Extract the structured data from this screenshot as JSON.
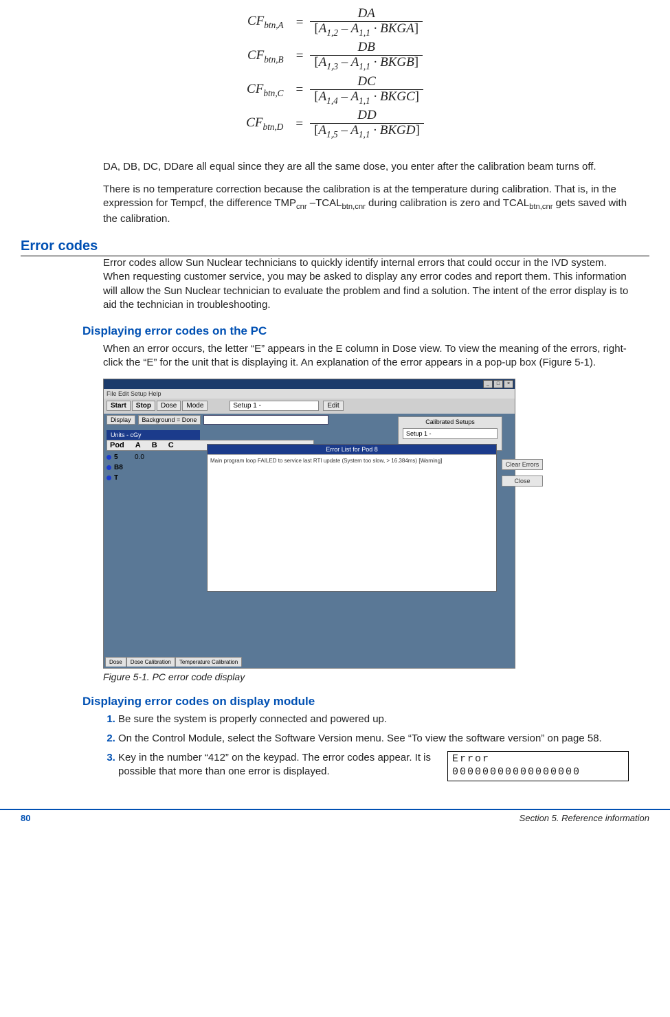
{
  "equations": [
    {
      "lhs_base": "CF",
      "lhs_sub": "btn,A",
      "num": "DA",
      "den_a2": "1,2",
      "den_a1": "1,1",
      "den_bk": "BKGA"
    },
    {
      "lhs_base": "CF",
      "lhs_sub": "btn,B",
      "num": "DB",
      "den_a2": "1,3",
      "den_a1": "1,1",
      "den_bk": "BKGB"
    },
    {
      "lhs_base": "CF",
      "lhs_sub": "btn,C",
      "num": "DC",
      "den_a2": "1,4",
      "den_a1": "1,1",
      "den_bk": "BKGC"
    },
    {
      "lhs_base": "CF",
      "lhs_sub": "btn,D",
      "num": "DD",
      "den_a2": "1,5",
      "den_a1": "1,1",
      "den_bk": "BKGD"
    }
  ],
  "para1": "DA, DB, DC, DDare all equal since they are all the same dose, you enter after the calibration beam turns off.",
  "para2a": "There is no temperature correction because the calibration is at the temperature during calibration. That is, in the expression for Tempcf, the difference TMP",
  "para2_sub1": "cnr",
  "para2b": " –TCAL",
  "para2_sub2": "btn,cnr",
  "para2c": " during calibration is zero and TCAL",
  "para2_sub3": "btn,cnr",
  "para2d": " gets saved with the calibration.",
  "h2_error": "Error codes",
  "para3": "Error codes allow Sun Nuclear technicians to quickly identify internal errors that could occur in the IVD system. When requesting customer service, you may be asked to display any error codes and report them. This information will allow the Sun Nuclear technician to evaluate the problem and find a solution. The intent of the error display is to aid the technician in troubleshooting.",
  "h3_pc": "Displaying error codes on the PC",
  "para4": "When an error occurs, the letter “E” appears in the E column in Dose view. To view the meaning of the errors, right-click the “E” for the unit that is displaying it. An explanation of the error appears in a pop-up box (Figure 5-1).",
  "figure": {
    "menubar": "File  Edit  Setup  Help",
    "btn_start": "Start",
    "btn_stop": "Stop",
    "btn_dose": "Dose",
    "btn_mode": "Mode",
    "setup_sel": "Setup 1 -",
    "btn_edit": "Edit",
    "chip_display": "Display",
    "chip_bg": "Background = Done",
    "calib_title": "Calibrated Setups",
    "calib_item": "Setup 1 -",
    "units": "Units - cGy",
    "pod_hdr": [
      "Pod",
      "A",
      "B",
      "C"
    ],
    "rows": [
      {
        "lbl": "5",
        "val": "0.0"
      },
      {
        "lbl": "B8",
        "val": ""
      },
      {
        "lbl": "T",
        "val": ""
      }
    ],
    "err_title": "Error List for Pod 8",
    "err_body": "Main program loop FAILED to service last RTI update (System too slow, > 16.384ms)  [Warning]",
    "btn_clear": "Clear Errors",
    "btn_close": "Close",
    "tabs": [
      "Dose",
      "Dose Calibration",
      "Temperature Calibration"
    ],
    "caption": "Figure 5-1. PC error code display"
  },
  "h3_disp": "Displaying error codes on display module",
  "steps": {
    "s1": "Be sure the system is properly connected and powered up.",
    "s2": "On the Control Module, select the Software Version menu. See “To view the software version” on page 58.",
    "s3": "Key in the number “412” on the keypad. The error codes appear. It is possible that more than one error is displayed."
  },
  "lcd": "Error\n00000000000000000",
  "footer": {
    "page": "80",
    "section": "Section 5. Reference information"
  }
}
